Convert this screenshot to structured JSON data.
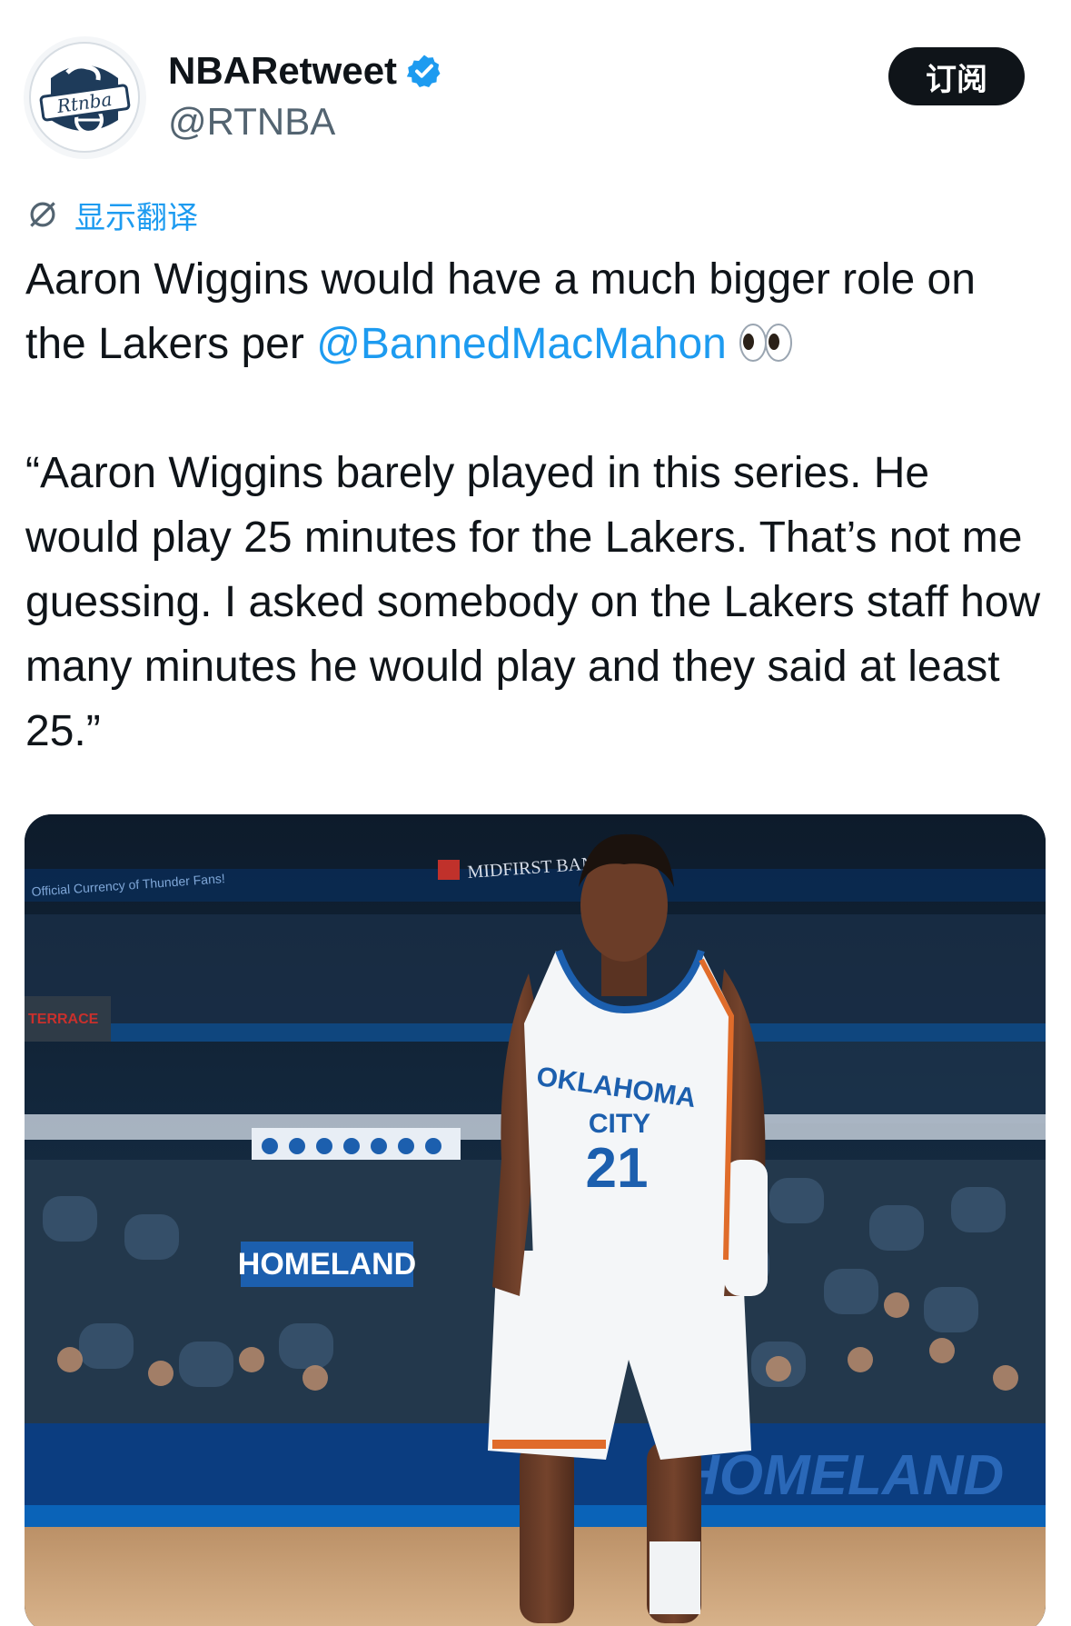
{
  "author": {
    "display_name": "NBARetweet",
    "handle": "@RTNBA",
    "avatar_logo_text": "Rtnba"
  },
  "subscribe_button": {
    "label": "订阅"
  },
  "translate": {
    "label": "显示翻译",
    "icon": "translate-icon"
  },
  "tweet": {
    "line1": "Aaron Wiggins would have a much bigger role on",
    "line2_prefix": "the Lakers per ",
    "mention": "@BannedMacMahon",
    "emoji": "👀",
    "quote": "“Aaron Wiggins barely played in this series. He would play 25 minutes for the Lakers. That’s not me guessing. I asked somebody on the Lakers staff how many minutes he would play and they said at least 25.”"
  },
  "media": {
    "signage": {
      "bank": "MIDFIRST BANK",
      "currency": "Official Currency of Thunder Fans!",
      "terrace": "TERRACE",
      "homeland": "HOMELAND",
      "jersey_city_top": "OKLAHOMA",
      "jersey_city_bottom": "CITY",
      "jersey_number": "21"
    }
  },
  "colors": {
    "accent": "#1d9bf0",
    "text": "#0f1419",
    "secondary": "#536471",
    "button_bg": "#0f1419",
    "thunder_blue": "#1c5fae",
    "court_blue": "#0a63b8"
  }
}
